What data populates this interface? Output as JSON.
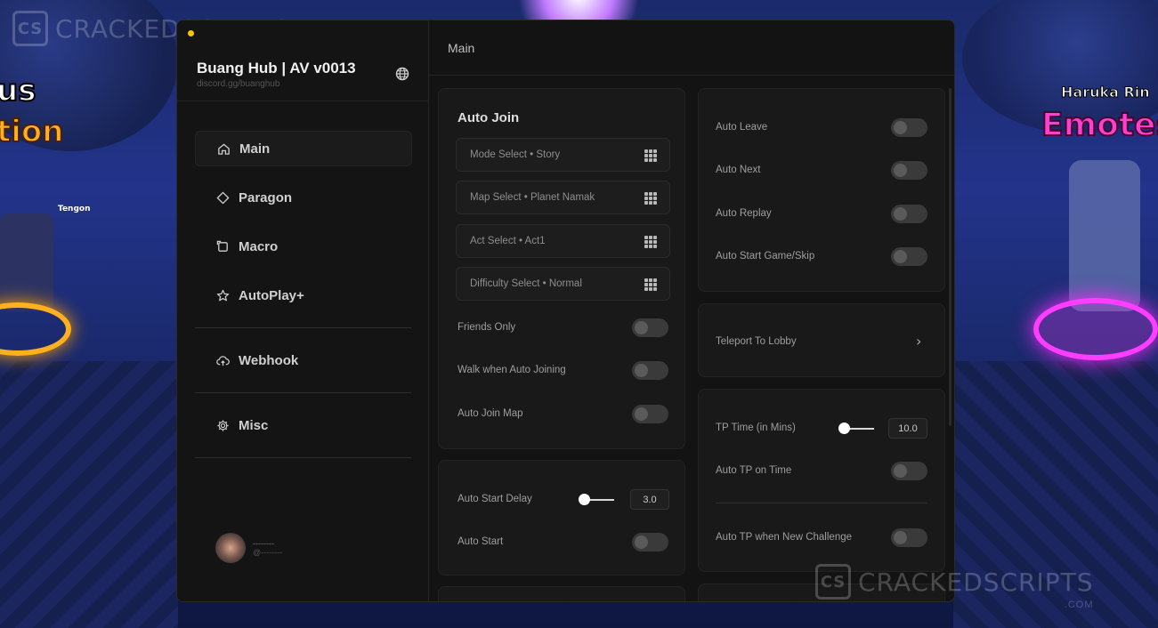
{
  "window": {
    "title": "Buang Hub | AV v0013",
    "discord": "discord.gg/buanghub",
    "header_label": "Main"
  },
  "sidebar": {
    "items": [
      {
        "label": "Main",
        "icon": "home-icon"
      },
      {
        "label": "Paragon",
        "icon": "diamond-icon"
      },
      {
        "label": "Macro",
        "icon": "macro-icon"
      },
      {
        "label": "AutoPlay+",
        "icon": "star-icon"
      },
      {
        "label": "Webhook",
        "icon": "cloud-upload-icon"
      },
      {
        "label": "Misc",
        "icon": "gear-icon"
      }
    ],
    "active": "Main",
    "user": {
      "name": "--------",
      "handle": "@--------"
    }
  },
  "auto_join": {
    "title": "Auto Join",
    "selects": [
      {
        "label": "Mode Select • Story"
      },
      {
        "label": "Map Select • Planet Namak"
      },
      {
        "label": "Act Select • Act1"
      },
      {
        "label": "Difficulty Select • Normal"
      }
    ],
    "toggles": [
      {
        "label": "Friends Only",
        "on": false
      },
      {
        "label": "Walk when Auto Joining",
        "on": false
      },
      {
        "label": "Auto Join Map",
        "on": false
      }
    ]
  },
  "auto_start": {
    "delay_label": "Auto Start Delay",
    "delay_value": "3.0",
    "delay_fraction": 0.15,
    "start_label": "Auto Start",
    "start_on": false
  },
  "right_toggles": [
    {
      "label": "Auto Leave",
      "on": false
    },
    {
      "label": "Auto Next",
      "on": false
    },
    {
      "label": "Auto Replay",
      "on": false
    },
    {
      "label": "Auto Start Game/Skip",
      "on": false
    }
  ],
  "teleport": {
    "label": "Teleport To Lobby",
    "chevron": "›"
  },
  "tp_time": {
    "label": "TP Time (in Mins)",
    "value": "10.0",
    "fraction": 0.15,
    "on_time_label": "Auto TP on Time",
    "challenge_label": "Auto TP when New Challenge"
  },
  "background": {
    "left_text_1": "us",
    "left_text_2": "tion",
    "npc_left": "Tengon",
    "npc_right": "Haruka Rin",
    "npc_right_sub": "Emotes"
  },
  "watermark": {
    "name": "CRACKEDSCRIPTS",
    "sub": ".COM",
    "logo": "CS"
  },
  "colors": {
    "accent_dot": "#f5c400",
    "panel": "#131313",
    "toggle_off": "#3a3a3a"
  }
}
